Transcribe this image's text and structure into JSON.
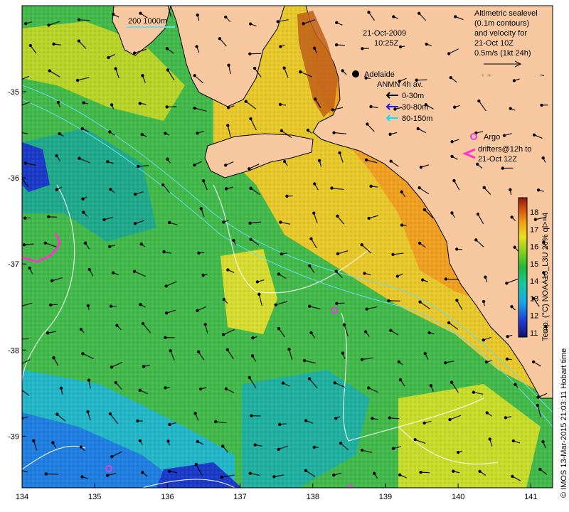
{
  "header": {
    "date": "21-Oct-2009",
    "time": "10:25Z"
  },
  "scale_bar": {
    "label": "200  1000m"
  },
  "altimetry_note": {
    "lines": [
      "Altimetric sealevel",
      "(0.1m contours)",
      "and velocity for",
      "21-Oct 10Z",
      "0.5m/s (1kt 24h)"
    ]
  },
  "city": {
    "name": "Adelaide"
  },
  "anmn_legend": {
    "title": "ANMN 4h av.",
    "items": [
      {
        "label": "0-30m",
        "color": "#000000"
      },
      {
        "label": "30-80m",
        "color": "#1a1aff"
      },
      {
        "label": "80-150m",
        "color": "#00e5ff"
      }
    ]
  },
  "argo_legend": {
    "argo_label": "Argo",
    "drifter_lines": [
      "drifters@12h to",
      "21-Oct 12Z"
    ],
    "argo_color": "#e040e0",
    "drifter_color": "#ff33cc"
  },
  "colorbar": {
    "ticks": [
      "18",
      "17",
      "16",
      "15",
      "14",
      "13",
      "12",
      "11"
    ],
    "label": "Temp. (°C) NOAA16_L3U 26% ql>=4"
  },
  "right_margin_text": "© IMOS 13-Mar-2015 21:03:11  Hobart time",
  "axes": {
    "x_ticks": [
      "134",
      "135",
      "136",
      "137",
      "138",
      "139",
      "140",
      "141"
    ],
    "y_ticks": [
      "-35",
      "-36",
      "-37",
      "-38",
      "-39"
    ],
    "xlim": [
      134,
      141.3
    ],
    "ylim": [
      -39.6,
      -34.0
    ]
  },
  "colors": {
    "land": "#f8c8a0",
    "contour": "#ffffff",
    "isobath": "#66ddee"
  }
}
